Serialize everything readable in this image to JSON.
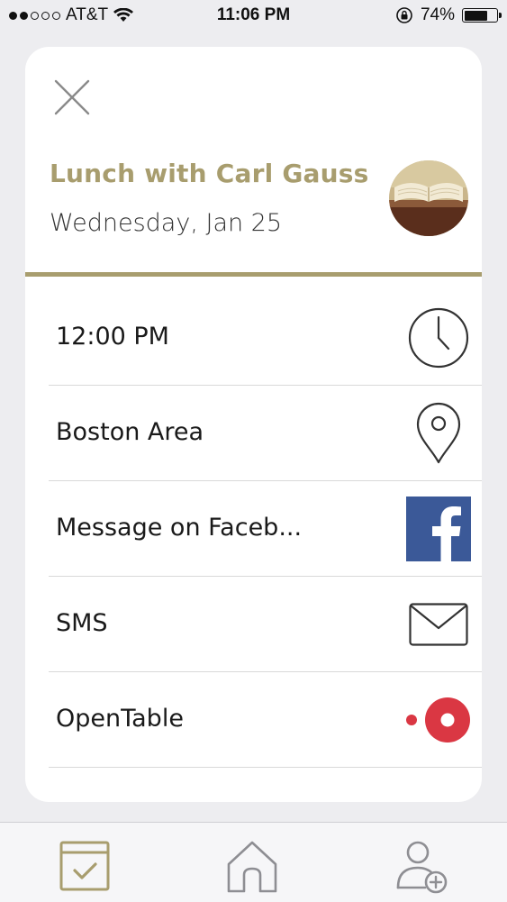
{
  "status_bar": {
    "carrier": "AT&T",
    "time": "11:06 PM",
    "battery_percent": "74%",
    "battery_level": 0.74,
    "signal_bars_filled": 2,
    "signal_bars_total": 5
  },
  "event": {
    "title": "Lunch with Carl Gauss",
    "date": "Wednesday, Jan 25",
    "accent_color": "#a89d6e"
  },
  "rows": [
    {
      "label": "12:00 PM",
      "icon": "clock-icon"
    },
    {
      "label": "Boston Area",
      "icon": "location-pin-icon"
    },
    {
      "label": "Message on Faceb...",
      "icon": "facebook-icon"
    },
    {
      "label": "SMS",
      "icon": "envelope-icon"
    },
    {
      "label": "OpenTable",
      "icon": "opentable-icon"
    }
  ],
  "colors": {
    "facebook": "#3b5998",
    "opentable": "#da3743",
    "accent": "#a89d6e"
  },
  "tab_bar": {
    "tabs": [
      {
        "icon": "calendar-check-icon",
        "active": true
      },
      {
        "icon": "home-icon",
        "active": false
      },
      {
        "icon": "add-user-icon",
        "active": false
      }
    ]
  }
}
